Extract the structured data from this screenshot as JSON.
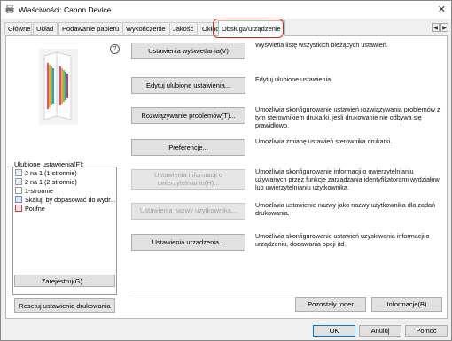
{
  "window": {
    "title": "Właściwości: Canon Device",
    "close_glyph": "✕"
  },
  "tabs": [
    "Główne",
    "Układ",
    "Podawanie papieru",
    "Wykończenie",
    "Jakość",
    "Okładk",
    "Obsługa/urządzenie"
  ],
  "active_tab": "Obsługa/urządzenie",
  "help_glyph": "?",
  "colors": {
    "highlight": "#d9261c",
    "panel": "#ffffff",
    "button": "#e1e1e1"
  },
  "favorites": {
    "label": "Ulubione ustawienia(F):",
    "items": [
      {
        "label": "2 na 1 (1-stronnie)",
        "icon": "doc-icon"
      },
      {
        "label": "2 na 1 (2-stronnie)",
        "icon": "doc-icon"
      },
      {
        "label": "1-stronnie",
        "icon": "doc-icon"
      },
      {
        "label": "Skaluj, by dopasować do wydr...",
        "icon": "fit-icon"
      },
      {
        "label": "Poufne",
        "icon": "confidential-icon"
      }
    ],
    "register_button": "Zarejestruj(G)..."
  },
  "reset_button": "Resetuj ustawienia drukowania",
  "actions": [
    {
      "label": "Ustawienia wyświetlania(V)",
      "desc": "Wyświetla listę wszystkich bieżących ustawień.",
      "enabled": true
    },
    {
      "label": "Edytuj ulubione ustawienia...",
      "desc": "Edytuj ulubione ustawienia.",
      "enabled": true
    },
    {
      "label": "Rozwiązywanie problemów(T)...",
      "desc": "Umożliwia skonfigurowanie ustawień rozwiązywania problemów z tym sterownikiem drukarki, jeśli drukowanie nie odbywa się prawidłowo.",
      "enabled": true
    },
    {
      "label": "Preferencje...",
      "desc": "Umożliwia zmianę ustawień sterownika drukarki.",
      "enabled": true
    },
    {
      "label": "Ustawienia informacji o uwierzytelnianiu(H)...",
      "desc": "Umożliwia skonfigurowanie informacji o uwierzytelnianiu używanych przez funkcje zarządzania identyfikatorami wydziałów lub uwierzytelnianiu użytkownika.",
      "enabled": false
    },
    {
      "label": "Ustawienia nazwy użytkownika...",
      "desc": "Umożliwia ustawienie nazwy jako nazwy użytkownika dla zadań drukowania.",
      "enabled": false
    },
    {
      "label": "Ustawienia urządzenia...",
      "desc": "Umożliwia skonfigurowanie ustawień uzyskiwania informacji o urządzeniu, dodawania opcji itd.",
      "enabled": true
    }
  ],
  "bottom_panel": {
    "toner_button": "Pozostały toner",
    "info_button": "Informacje(B)"
  },
  "dialog_buttons": {
    "ok": "OK",
    "cancel": "Anuluj",
    "help": "Pomoc"
  }
}
